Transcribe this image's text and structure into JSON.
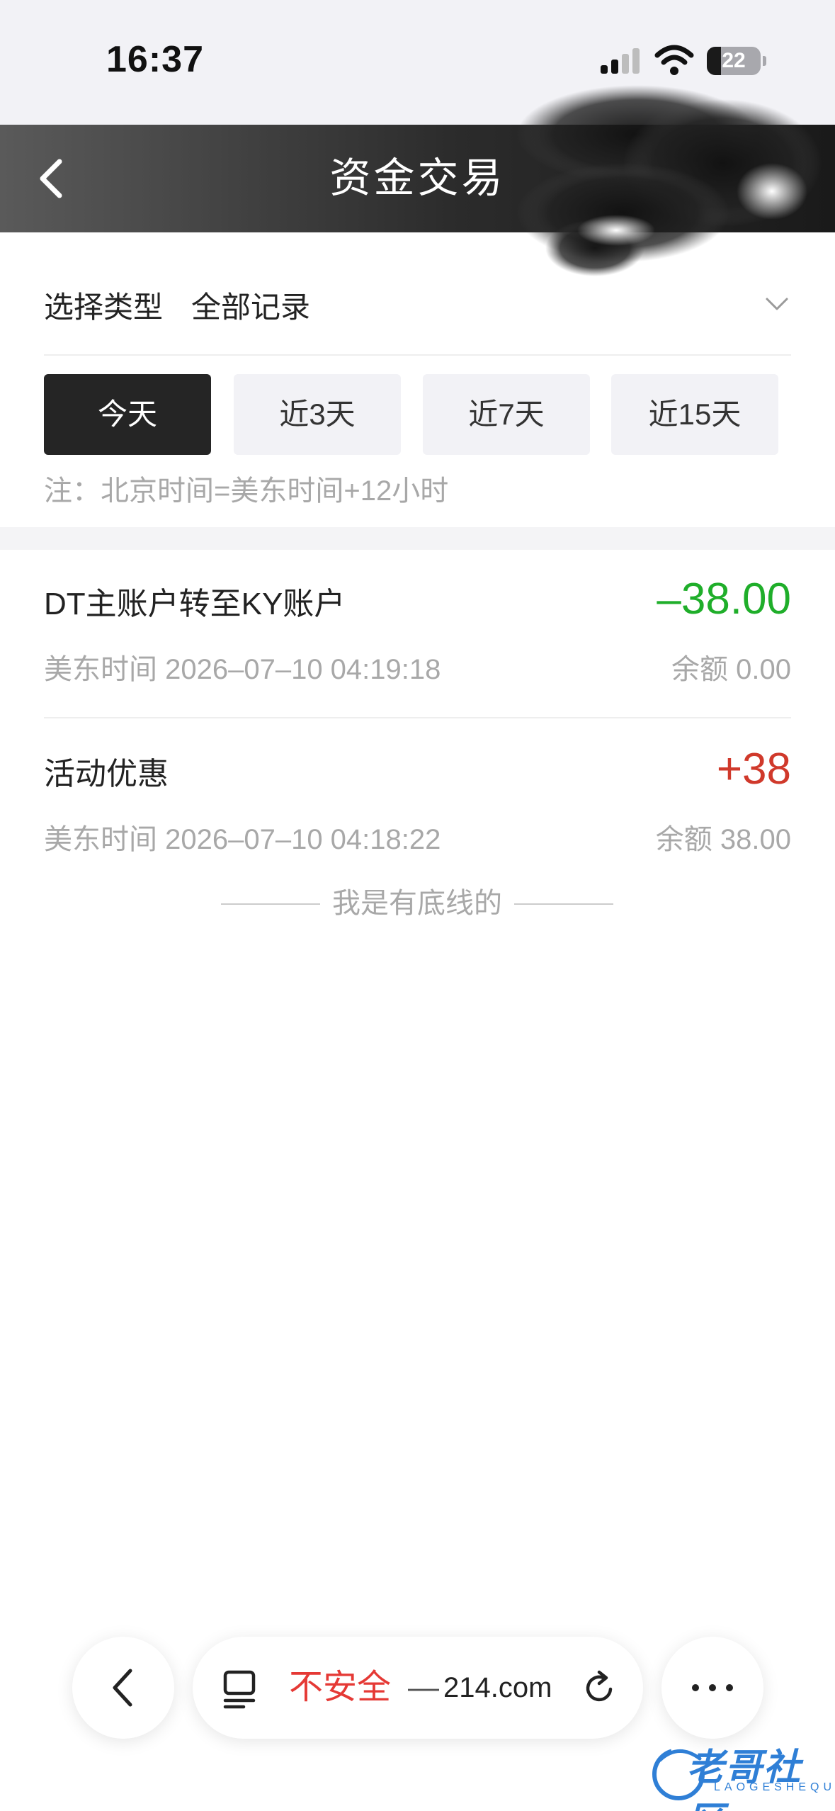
{
  "status_bar": {
    "time": "16:37",
    "battery": "22"
  },
  "header": {
    "title": "资金交易"
  },
  "filter": {
    "label": "选择类型",
    "value": "全部记录"
  },
  "tabs": [
    {
      "label": "今天",
      "active": true
    },
    {
      "label": "近3天",
      "active": false
    },
    {
      "label": "近7天",
      "active": false
    },
    {
      "label": "近15天",
      "active": false
    }
  ],
  "note": "注：北京时间=美东时间+12小时",
  "records": [
    {
      "title": "DT主账户转至KY账户",
      "amount": "–38.00",
      "time": "美东时间 2026–07–10 04:19:18",
      "balance": "余额 0.00"
    },
    {
      "title": "活动优惠",
      "amount": "+38",
      "time": "美东时间 2026–07–10 04:18:22",
      "balance": "余额 38.00"
    }
  ],
  "end_text": "我是有底线的",
  "browser": {
    "security": "不安全",
    "dash": "—",
    "url": "214.com"
  },
  "watermark": {
    "text": "老哥社区",
    "sub": "LAOGESHEQU"
  },
  "colors": {
    "negative": "#1fae2a",
    "positive": "#d0392b",
    "insecure": "#e53935",
    "active_tab": "#252525"
  }
}
